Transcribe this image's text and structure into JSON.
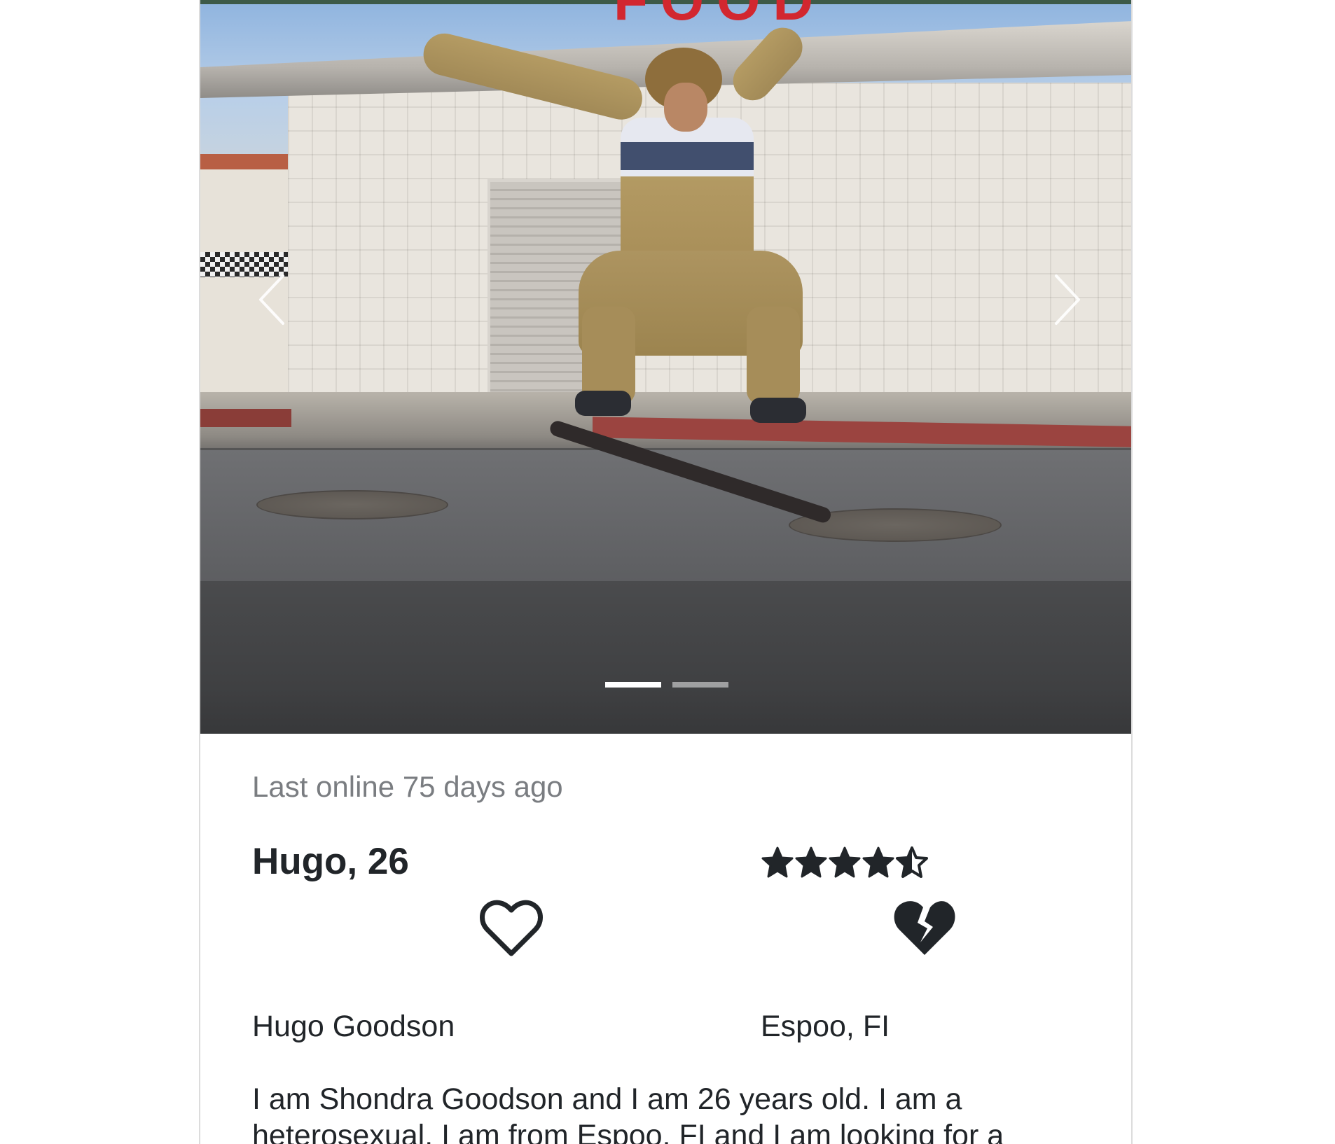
{
  "carousel": {
    "photo_alt": "skateboarder",
    "sign_text": "FOOD",
    "slides": 2,
    "active_slide": 1,
    "prev_icon": "chevron-left-icon",
    "next_icon": "chevron-right-icon"
  },
  "profile": {
    "last_online": "Last online 75 days ago",
    "name_age": "Hugo, 26",
    "rating": 4.5,
    "rating_max": 5,
    "like_icon": "heart-outline-icon",
    "dislike_icon": "broken-heart-icon",
    "full_name": "Hugo Goodson",
    "location": "Espoo, FI",
    "bio": "I am Shondra Goodson and I am 26 years old. I am a heterosexual. I am from Espoo, FI and I am looking for a"
  },
  "colors": {
    "text": "#212529",
    "muted": "#7a7d81",
    "border": "#dcdcdc"
  }
}
